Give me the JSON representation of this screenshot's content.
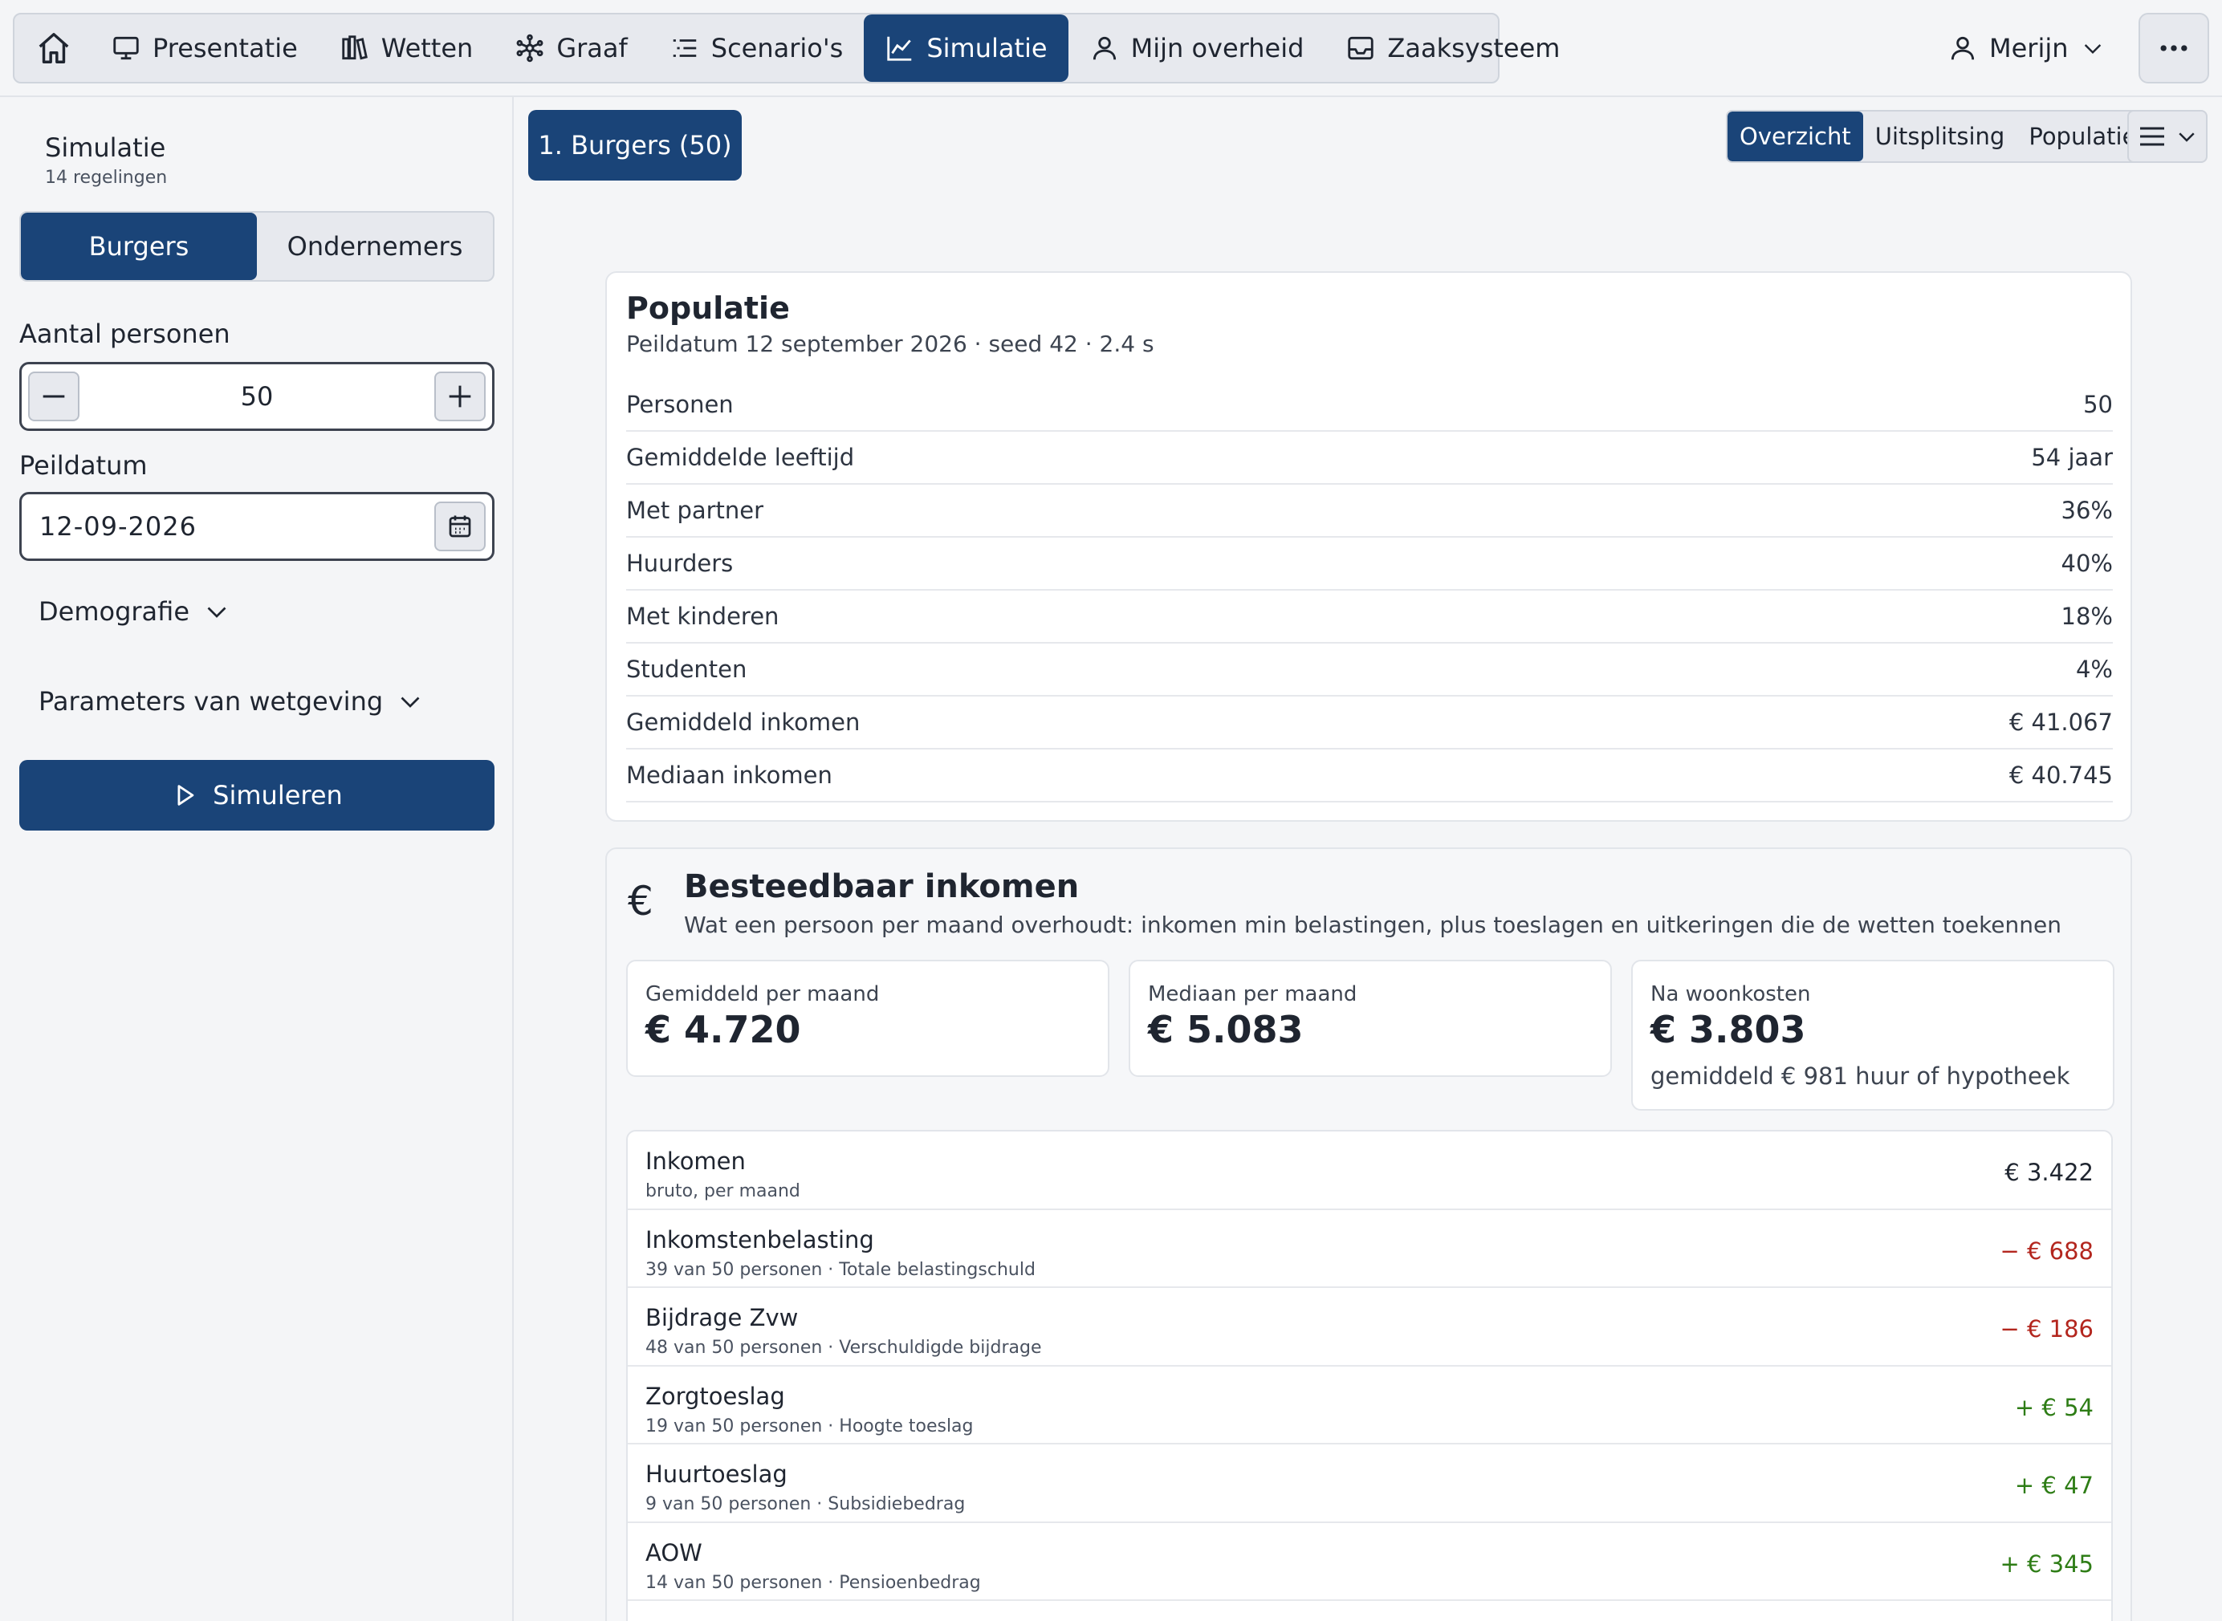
{
  "nav": {
    "items": [
      {
        "label": "Presentatie",
        "icon": "monitor-icon"
      },
      {
        "label": "Wetten",
        "icon": "books-icon"
      },
      {
        "label": "Graaf",
        "icon": "graph-icon"
      },
      {
        "label": "Scenario's",
        "icon": "list-icon"
      },
      {
        "label": "Simulatie",
        "icon": "chart-icon"
      },
      {
        "label": "Mijn overheid",
        "icon": "person-icon"
      },
      {
        "label": "Zaaksysteem",
        "icon": "inbox-icon"
      }
    ],
    "active": "Simulatie",
    "user": "Merijn"
  },
  "sidebar": {
    "title": "Simulatie",
    "subtitle": "14 regelingen",
    "segments": [
      "Burgers",
      "Ondernemers"
    ],
    "active_segment": "Burgers",
    "persons_label": "Aantal personen",
    "persons_value": "50",
    "date_label": "Peildatum",
    "date_value": "12-09-2026",
    "demografie": "Demografie",
    "parameters": "Parameters van wetgeving",
    "run_label": "Simuleren"
  },
  "main": {
    "tab_label": "1. Burgers (50)",
    "views": [
      "Overzicht",
      "Uitsplitsing",
      "Populatie"
    ],
    "active_view": "Overzicht"
  },
  "population": {
    "title": "Populatie",
    "subtitle": "Peildatum 12 september 2026 · seed 42 · 2.4 s",
    "rows": [
      {
        "label": "Personen",
        "value": "50"
      },
      {
        "label": "Gemiddelde leeftijd",
        "value": "54 jaar"
      },
      {
        "label": "Met partner",
        "value": "36%"
      },
      {
        "label": "Huurders",
        "value": "40%"
      },
      {
        "label": "Met kinderen",
        "value": "18%"
      },
      {
        "label": "Studenten",
        "value": "4%"
      },
      {
        "label": "Gemiddeld inkomen",
        "value": "€ 41.067"
      },
      {
        "label": "Mediaan inkomen",
        "value": "€ 40.745"
      }
    ]
  },
  "income": {
    "icon_symbol": "€",
    "title": "Besteedbaar inkomen",
    "subtitle": "Wat een persoon per maand overhoudt: inkomen min belastingen, plus toeslagen en uitkeringen die de wetten toekennen",
    "stats": [
      {
        "label": "Gemiddeld per maand",
        "value": "€ 4.720",
        "note": ""
      },
      {
        "label": "Mediaan per maand",
        "value": "€ 5.083",
        "note": ""
      },
      {
        "label": "Na woonkosten",
        "value": "€ 3.803",
        "note": "gemiddeld € 981 huur of hypotheek"
      }
    ],
    "ledger": [
      {
        "title": "Inkomen",
        "sub": "bruto, per maand",
        "amount": "€ 3.422",
        "tone": "neutral"
      },
      {
        "title": "Inkomstenbelasting",
        "sub": "39 van 50 personen · Totale belastingschuld",
        "amount": "− € 688",
        "tone": "negative"
      },
      {
        "title": "Bijdrage Zvw",
        "sub": "48 van 50 personen · Verschuldigde bijdrage",
        "amount": "− € 186",
        "tone": "negative"
      },
      {
        "title": "Zorgtoeslag",
        "sub": "19 van 50 personen · Hoogte toeslag",
        "amount": "+ € 54",
        "tone": "positive"
      },
      {
        "title": "Huurtoeslag",
        "sub": "9 van 50 personen · Subsidiebedrag",
        "amount": "+ € 47",
        "tone": "positive"
      },
      {
        "title": "AOW",
        "sub": "14 van 50 personen · Pensioenbedrag",
        "amount": "+ € 345",
        "tone": "positive"
      }
    ]
  },
  "colors": {
    "accent": "#1a4478",
    "negative": "#b3261e",
    "positive": "#2e7d16",
    "neutral": "#1f2530"
  }
}
